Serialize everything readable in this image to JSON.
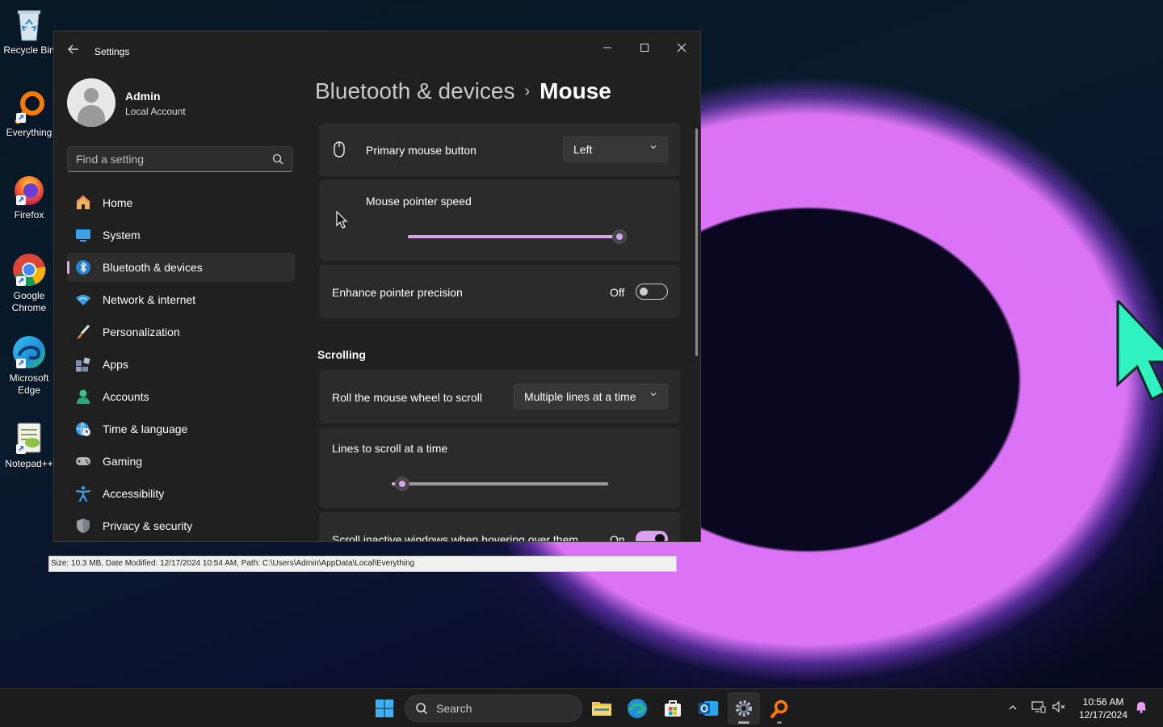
{
  "desktop": {
    "icons": [
      {
        "label": "Recycle Bin",
        "icon": "recycle-bin-icon"
      },
      {
        "label": "Everything",
        "icon": "everything-icon"
      },
      {
        "label": "Firefox",
        "icon": "firefox-icon"
      },
      {
        "label": "Google Chrome",
        "icon": "chrome-icon"
      },
      {
        "label": "Microsoft Edge",
        "icon": "edge-icon"
      },
      {
        "label": "Notepad++",
        "icon": "notepadpp-icon"
      }
    ]
  },
  "everything_status": "Size: 10.3 MB, Date Modified: 12/17/2024 10:54 AM, Path: C:\\Users\\Admin\\AppData\\Local\\Everything",
  "settings": {
    "title": "Settings",
    "user": {
      "name": "Admin",
      "account_type": "Local Account"
    },
    "search_placeholder": "Find a setting",
    "nav": [
      {
        "label": "Home",
        "icon": "home-icon",
        "active": false
      },
      {
        "label": "System",
        "icon": "system-icon",
        "active": false
      },
      {
        "label": "Bluetooth & devices",
        "icon": "bluetooth-icon",
        "active": true
      },
      {
        "label": "Network & internet",
        "icon": "wifi-icon",
        "active": false
      },
      {
        "label": "Personalization",
        "icon": "brush-icon",
        "active": false
      },
      {
        "label": "Apps",
        "icon": "apps-icon",
        "active": false
      },
      {
        "label": "Accounts",
        "icon": "person-icon",
        "active": false
      },
      {
        "label": "Time & language",
        "icon": "globe-clock-icon",
        "active": false
      },
      {
        "label": "Gaming",
        "icon": "gamepad-icon",
        "active": false
      },
      {
        "label": "Accessibility",
        "icon": "accessibility-icon",
        "active": false
      },
      {
        "label": "Privacy & security",
        "icon": "shield-icon",
        "active": false
      }
    ],
    "breadcrumb": {
      "parent": "Bluetooth & devices",
      "separator": "›",
      "current": "Mouse"
    },
    "primary_button": {
      "label": "Primary mouse button",
      "value": "Left"
    },
    "pointer_speed": {
      "label": "Mouse pointer speed",
      "value_fraction": 1.0
    },
    "enhance_precision": {
      "label": "Enhance pointer precision",
      "state_text": "Off",
      "on": false
    },
    "scrolling": {
      "heading": "Scrolling",
      "roll_wheel": {
        "label": "Roll the mouse wheel to scroll",
        "value": "Multiple lines at a time"
      },
      "lines_to_scroll": {
        "label": "Lines to scroll at a time",
        "value_fraction": 0.05
      },
      "scroll_inactive": {
        "label": "Scroll inactive windows when hovering over them",
        "state_text": "On",
        "on": true
      }
    }
  },
  "taskbar": {
    "search_label": "Search",
    "time": "10:56 AM",
    "date": "12/17/2024"
  },
  "colors": {
    "accent": "#d9a2ec",
    "big_cursor": "#2ef2c0"
  }
}
